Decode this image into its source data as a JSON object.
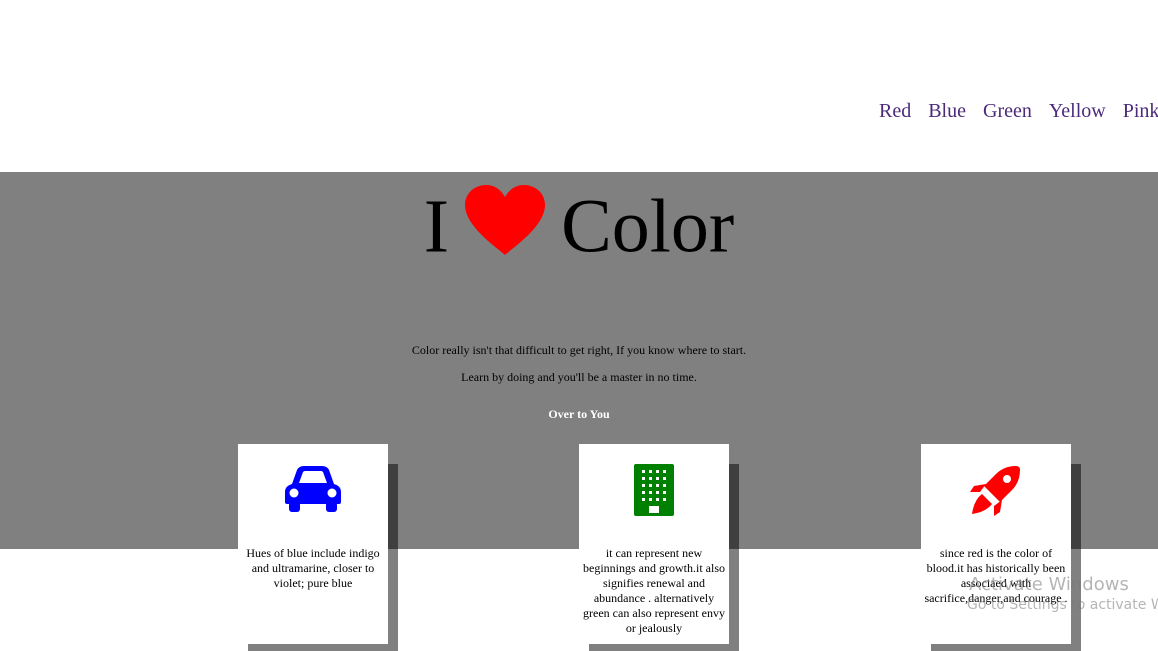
{
  "nav": {
    "items": [
      "Red",
      "Blue",
      "Green",
      "Yellow",
      "Pink"
    ]
  },
  "hero": {
    "title_left": "I",
    "title_right": "Color",
    "heart_icon": "heart-icon",
    "heart_color": "#ff0000",
    "background": "#808080",
    "line1": "Color really isn't that difficult to get right, If you know where to start.",
    "line2": "Learn by doing and you'll be a master in no time.",
    "cta": "Over to You"
  },
  "cards": [
    {
      "icon": "car-icon",
      "icon_color": "#0000ff",
      "text": "Hues of blue include indigo and ultramarine, closer to violet; pure blue"
    },
    {
      "icon": "building-icon",
      "icon_color": "#008000",
      "text": "it can represent new beginnings and growth.it also signifies renewal and abundance . alternatively green can also represent envy or jealously"
    },
    {
      "icon": "rocket-icon",
      "icon_color": "#ff0000",
      "text": "since red is the color of blood.it has historically been associaed with sacrifice,danger,and courage ."
    }
  ],
  "watermark": {
    "line1": "Activate Windows",
    "line2": "Go to Settings to activate Windows."
  }
}
